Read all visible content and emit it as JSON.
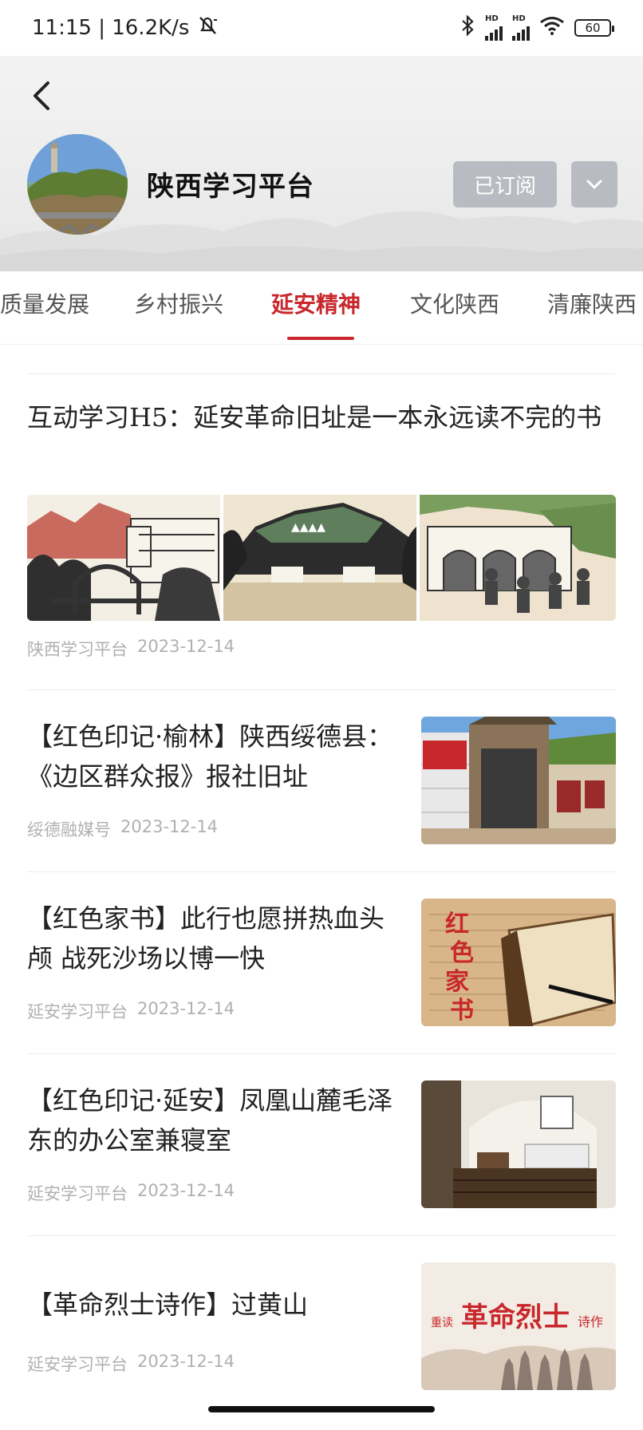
{
  "status_bar": {
    "time_speed": "11:15 | 16.2K/s",
    "battery": "60",
    "hd1": "HD",
    "hd2": "HD"
  },
  "header": {
    "account_name": "陕西学习平台",
    "subscribed_label": "已订阅"
  },
  "tabs": [
    {
      "label": "质量发展"
    },
    {
      "label": "乡村振兴"
    },
    {
      "label": "延安精神"
    },
    {
      "label": "文化陕西"
    },
    {
      "label": "清廉陕西"
    }
  ],
  "active_tab_index": 2,
  "articles": [
    {
      "title": "互动学习H5：延安革命旧址是一本永远读不完的书",
      "source": "陕西学习平台",
      "date": "2023-12-14"
    },
    {
      "title": "【红色印记·榆林】陕西绥德县：《边区群众报》报社旧址",
      "source": "绥德融媒号",
      "date": "2023-12-14"
    },
    {
      "title": "【红色家书】此行也愿拼热血头颅 战死沙场以博一快",
      "source": "延安学习平台",
      "date": "2023-12-14"
    },
    {
      "title": "【红色印记·延安】凤凰山麓毛泽东的办公室兼寝室",
      "source": "延安学习平台",
      "date": "2023-12-14"
    },
    {
      "title": "【革命烈士诗作】过黄山",
      "source": "延安学习平台",
      "date": "2023-12-14",
      "thumb_text_small": "重读",
      "thumb_text_big": "革命烈士",
      "thumb_text_end": "诗作"
    }
  ],
  "letter_thumb_text": "红色家书",
  "colors": {
    "accent": "#c8282c",
    "meta": "#b0b0b0",
    "button_gray": "#b8bcc2"
  }
}
